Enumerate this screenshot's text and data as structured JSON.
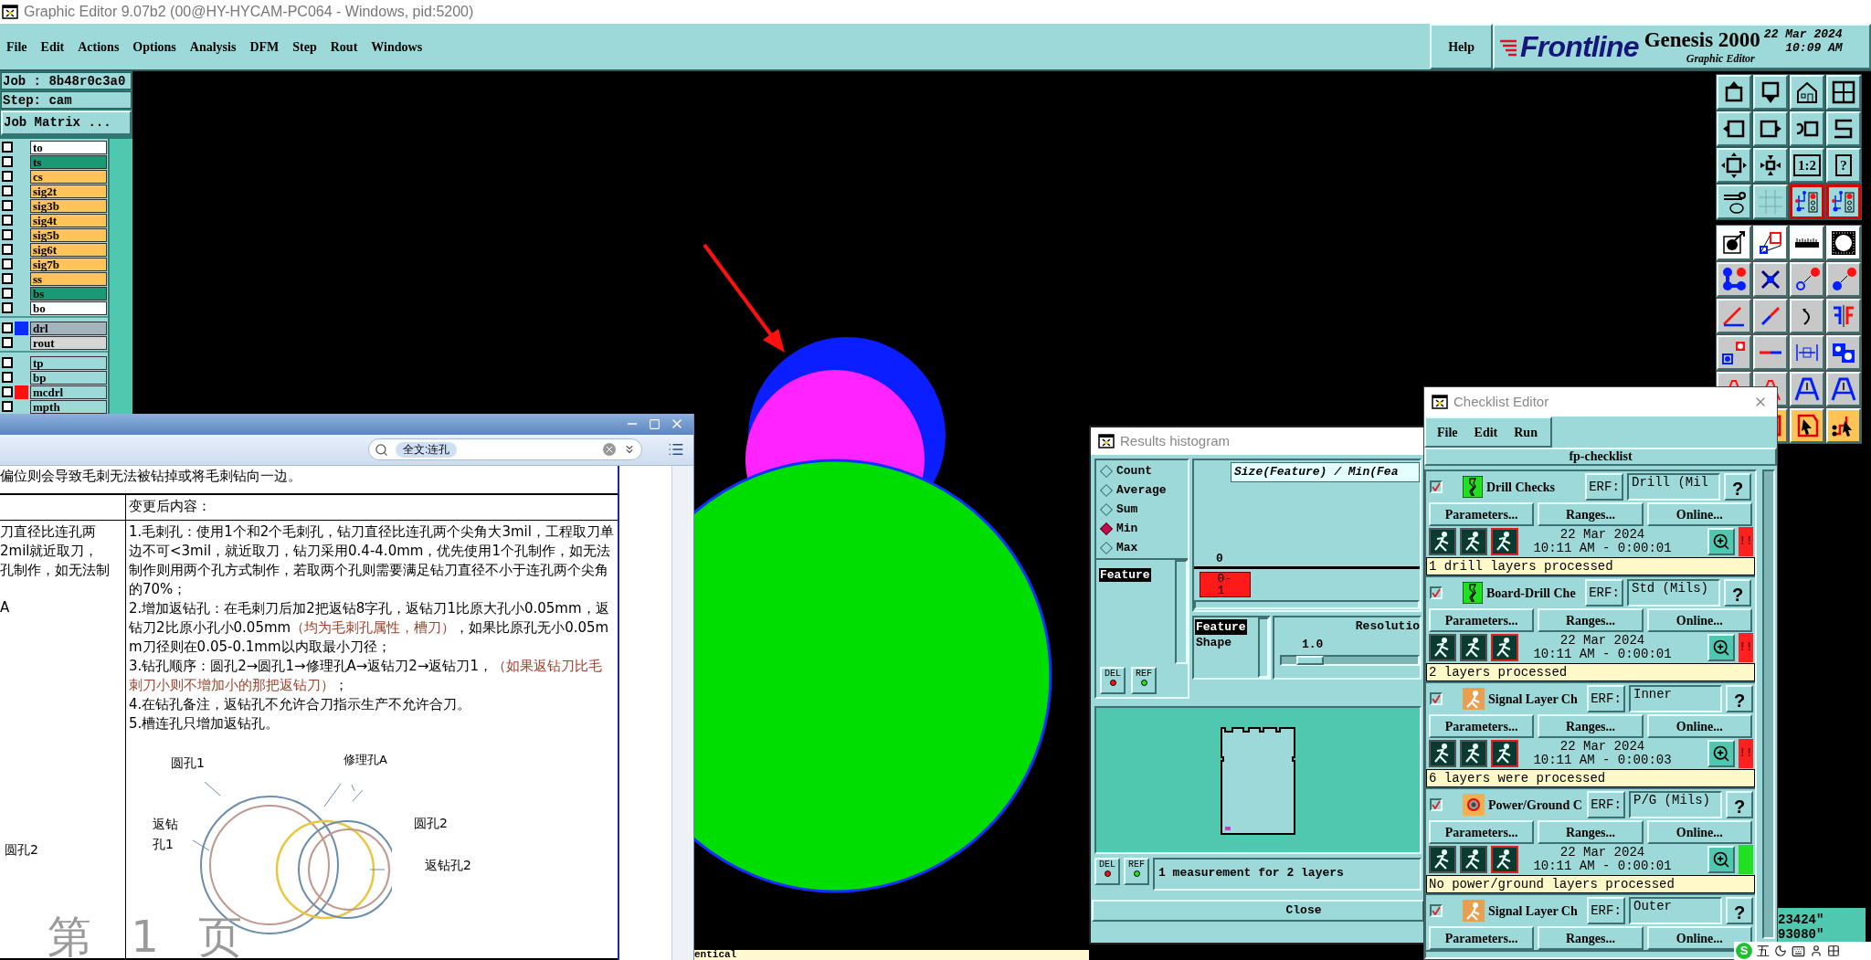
{
  "window": {
    "title": "Graphic Editor 9.07b2 (00@HY-HYCAM-PC064 - Windows, pid:5200)"
  },
  "menu": [
    "File",
    "Edit",
    "Actions",
    "Options",
    "Analysis",
    "DFM",
    "Step",
    "Rout",
    "Windows"
  ],
  "help": "Help",
  "brand": {
    "logo": "Frontline",
    "product": "Genesis 2000",
    "subtitle": "Graphic Editor",
    "date": "22 Mar 2024",
    "time": "10:09 AM"
  },
  "job": {
    "job": "Job : 8b48r0c3a0",
    "step": "Step: cam",
    "matrix_button": "Job Matrix ..."
  },
  "layer_groups": [
    [
      {
        "name": "to",
        "kind": "silk",
        "checked": false
      },
      {
        "name": "ts",
        "kind": "mask",
        "checked": false
      },
      {
        "name": "cs",
        "kind": "signal",
        "checked": false
      },
      {
        "name": "sig2t",
        "kind": "signal",
        "checked": false
      },
      {
        "name": "sig3b",
        "kind": "signal",
        "checked": false
      },
      {
        "name": "sig4t",
        "kind": "signal",
        "checked": false
      },
      {
        "name": "sig5b",
        "kind": "signal",
        "checked": false
      },
      {
        "name": "sig6t",
        "kind": "signal",
        "checked": false
      },
      {
        "name": "sig7b",
        "kind": "signal",
        "checked": false
      },
      {
        "name": "ss",
        "kind": "signal",
        "checked": false
      },
      {
        "name": "bs",
        "kind": "mask",
        "checked": false
      },
      {
        "name": "bo",
        "kind": "silk",
        "checked": false
      }
    ],
    [
      {
        "name": "drl",
        "kind": "drill",
        "checked": false,
        "color": "#0a2cff"
      },
      {
        "name": "rout",
        "kind": "rout",
        "checked": false
      }
    ],
    [
      {
        "name": "tp",
        "kind": "document",
        "checked": false
      },
      {
        "name": "bp",
        "kind": "document",
        "checked": false
      },
      {
        "name": "mcdrl",
        "kind": "document",
        "checked": false,
        "color": "#ff1010"
      },
      {
        "name": "mpth",
        "kind": "document",
        "checked": false
      }
    ]
  ],
  "toolbar_labels": [
    "1:2",
    "?"
  ],
  "status_line": "entical",
  "coordinates": [
    "23424\"",
    "93080\""
  ],
  "document": {
    "search": "全文:连孔",
    "intro": "偏位则会导致毛刺无法被钻掉或将毛刺钻向一边。",
    "header_right": "变更后内容：",
    "left_lines": [
      "刀直径比连孔两",
      "2mil就近取刀，",
      "孔制作，如无法制"
    ],
    "left_label_a": "A",
    "left_label_b": "圆孔2",
    "paragraphs": [
      [
        {
          "text": "1.毛刺孔：使用1个和2个毛刺孔，钻刀直径比连孔两个尖角大3mil，工程取刀单边不可<3mil，就近取刀，钻刀采用0.4-4.0mm，优先使用1个孔制作，如无法制作则用两个孔方式制作，若取两个孔则需要满足钻刀直径不小于连孔两个尖角的70%；",
          "highlight": false
        }
      ],
      [
        {
          "text": "2.增加返钻孔：在毛刺刀后加2把返钻8字孔，返钻刀1比原大孔小0.05mm，返钻刀2比原小孔小0.05mm",
          "highlight": false
        },
        {
          "text": "（均为毛刺孔属性，槽刀）",
          "highlight": true
        },
        {
          "text": "，如果比原孔无小0.05mm刀径则在0.05-0.1mm以内取最小刀径；",
          "highlight": false
        }
      ],
      [
        {
          "text": "3.钻孔顺序：圆孔2→圆孔1→修理孔A→返钻刀2→返钻刀1，",
          "highlight": false
        },
        {
          "text": "（如果返钻刀比毛刺刀小则不增加小的那把返钻刀）",
          "highlight": true
        },
        {
          "text": "；",
          "highlight": false
        }
      ],
      [
        {
          "text": "4.在钻孔备注，返钻孔不允许合刀指示生产不允许合刀。",
          "highlight": false
        }
      ],
      [
        {
          "text": "5.槽连孔只增加返钻孔。",
          "highlight": false
        }
      ]
    ],
    "diagram_labels": [
      "圆孔1",
      "修理孔A",
      "返钻孔1",
      "圆孔2",
      "返钻孔2"
    ],
    "page_label": "第 1 页"
  },
  "histogram": {
    "title": "Results histogram",
    "modes": [
      {
        "label": "Count",
        "selected": false
      },
      {
        "label": "Average",
        "selected": false
      },
      {
        "label": "Sum",
        "selected": false
      },
      {
        "label": "Min",
        "selected": true
      },
      {
        "label": "Max",
        "selected": false
      }
    ],
    "group_list": [
      {
        "label": "Feature",
        "selected": true
      }
    ],
    "buttons_top": [
      "DEL",
      "REF"
    ],
    "chart_title": "Size(Feature) / Min(Fea",
    "axis_label": "0",
    "bar_label": "0-1",
    "sort_list": [
      {
        "label": "Feature",
        "selected": true
      },
      {
        "label": "Shape",
        "selected": false
      }
    ],
    "resolution": {
      "label": "Resolutio",
      "value": "1.0"
    },
    "buttons_bottom": [
      "DEL",
      "REF"
    ],
    "message": "1 measurement for 2 layers",
    "close": "Close"
  },
  "checklist": {
    "title": "Checklist Editor",
    "menu": [
      "File",
      "Edit",
      "Run"
    ],
    "name": "fp-checklist",
    "items": [
      {
        "checked": true,
        "kind": "drill",
        "name": "Drill Checks",
        "erf_label": "ERF:",
        "erf": "Drill (Mil",
        "help": "?",
        "buttons": [
          "Parameters...",
          "Ranges...",
          "Online..."
        ],
        "date": "22 Mar 2024",
        "time": "10:11 AM - 0:00:01",
        "passed": false,
        "status_text": "!!",
        "message": "1 drill layers processed"
      },
      {
        "checked": true,
        "kind": "drill",
        "name": "Board-Drill Che",
        "erf_label": "ERF:",
        "erf": "Std (Mils)",
        "help": "?",
        "buttons": [
          "Parameters...",
          "Ranges...",
          "Online..."
        ],
        "date": "22 Mar 2024",
        "time": "10:11 AM - 0:00:01",
        "passed": false,
        "status_text": "!!",
        "message": "2 layers processed"
      },
      {
        "checked": true,
        "kind": "signal",
        "name": "Signal Layer Ch",
        "erf_label": "ERF:",
        "erf": "Inner",
        "help": "?",
        "buttons": [
          "Parameters...",
          "Ranges...",
          "Online..."
        ],
        "date": "22 Mar 2024",
        "time": "10:11 AM - 0:00:03",
        "passed": false,
        "status_text": "!!",
        "message": "6 layers were processed"
      },
      {
        "checked": true,
        "kind": "power",
        "name": "Power/Ground C",
        "erf_label": "ERF:",
        "erf": "P/G (Mils)",
        "help": "?",
        "buttons": [
          "Parameters...",
          "Ranges...",
          "Online..."
        ],
        "date": "22 Mar 2024",
        "time": "10:11 AM - 0:00:01",
        "passed": true,
        "message": "No power/ground layers processed"
      },
      {
        "checked": true,
        "kind": "signal",
        "name": "Signal Layer Ch",
        "erf_label": "ERF:",
        "erf": "Outer",
        "help": "?",
        "buttons": [
          "Parameters...",
          "Ranges...",
          "Online..."
        ]
      }
    ]
  },
  "ime": {
    "logo": "S",
    "mode": "五"
  }
}
